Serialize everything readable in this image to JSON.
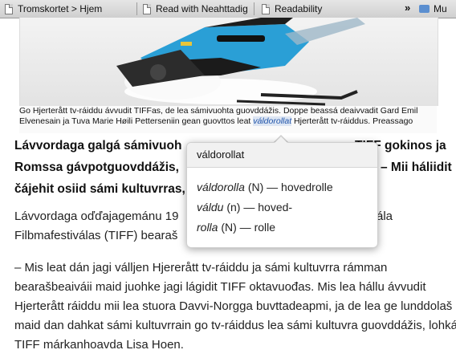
{
  "bookmarks": {
    "items": [
      {
        "label": "Tromskortet > Hjem"
      },
      {
        "label": "Read with Neahttadig"
      },
      {
        "label": "Readability"
      },
      {
        "label": "Mu"
      }
    ],
    "overflow": "»"
  },
  "caption": {
    "before": "Go Hjerterått tv-ráiddu ávvudit TIFFas, de lea sámivuohta guovddážis. Doppe beassá deaivvadit Gard Emil Elvenesain ja Tuva Marie Høili Petterseniin gean guovttos leat ",
    "highlight": "váldorollat",
    "after": " Hjerterått tv-ráiddus. Preassago"
  },
  "headline": {
    "line1": "Lávvordaga galgá sámivuoh",
    "line1_end": "TIFF gokinos ja",
    "line2": "Romssa gávpotguovddážis,",
    "line2_end": "– Mii háliidit",
    "line3": "čájehit osiid sámi kultuvrras,"
  },
  "para1": {
    "line1": "Lávvordaga oďďajagemánu 19",
    "line1_end": "ála",
    "line2": "Filbmafestiválas (TIFF) bearaš"
  },
  "para2": {
    "text": "– Mis leat dán jagi válljen Hjererått tv-ráiddu ja sámi kultuvrra rámman bearašbeaiváii maid juohke jagi lágidit TIFF oktavuođas. Mis lea hállu ávvudit Hjerterått ráiddu mii lea stuora Davvi-Norgga buvttadeapmi, ja de lea ge lunddolaš maid dan dahkat sámi kultuvrrain go tv-ráiddus lea sámi kultuvra guovddážis, lohká TIFF márkanhoavda Lisa Hoen."
  },
  "tooltip": {
    "title": "váldorollat",
    "l1_term": "váldorolla",
    "l1_rest": " (N) — hovedrolle",
    "l2_term": "váldu",
    "l2_rest": " (n) — hoved-",
    "l3_term": "rolla",
    "l3_rest": " (N) — rolle"
  },
  "colors": {
    "link_highlight": "#2255aa",
    "tooltip_header": "#f1f1f1"
  }
}
